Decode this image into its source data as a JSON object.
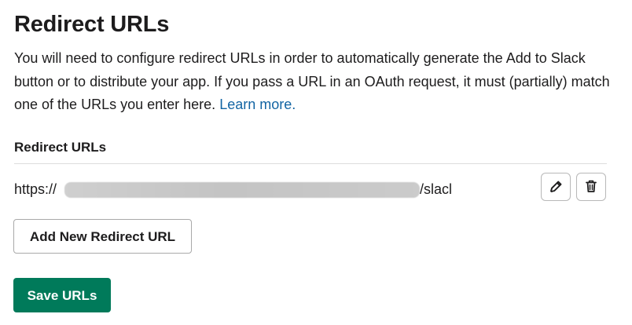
{
  "page": {
    "title": "Redirect URLs",
    "description": "You will need to configure redirect URLs in order to automatically generate the Add to Slack button or to distribute your app. If you pass a URL in an OAuth request, it must (partially) match one of the URLs you enter here.",
    "learn_more": "Learn more."
  },
  "redirect_urls": {
    "heading": "Redirect URLs",
    "items": [
      {
        "prefix": "https://",
        "suffix": "/slacl",
        "redacted": true,
        "edit_icon": "pencil-icon",
        "delete_icon": "trash-icon"
      }
    ]
  },
  "actions": {
    "add_label": "Add New Redirect URL",
    "save_label": "Save URLs"
  },
  "colors": {
    "text": "#1d1c1d",
    "link": "#1264a3",
    "primary_button": "#007a5a",
    "border": "#b8b8b8",
    "divider": "#dddddd"
  }
}
